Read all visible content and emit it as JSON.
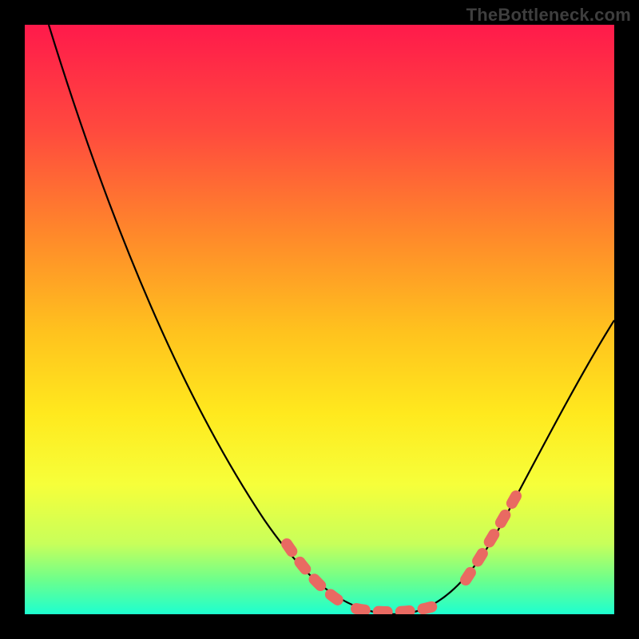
{
  "watermark": "TheBottleneck.com",
  "chart_data": {
    "type": "line",
    "title": "",
    "xlabel": "",
    "ylabel": "",
    "xlim": [
      0,
      100
    ],
    "ylim": [
      0,
      100
    ],
    "series": [
      {
        "name": "curve",
        "x": [
          4,
          10,
          16,
          22,
          28,
          34,
          40,
          46,
          50,
          54,
          58,
          62,
          66,
          70,
          74,
          78,
          82,
          86,
          90,
          94,
          98,
          100
        ],
        "y": [
          100,
          88,
          76,
          64,
          52,
          40,
          29,
          19,
          12,
          7,
          3,
          1,
          0,
          0.5,
          2,
          5,
          9,
          14,
          20,
          27,
          35,
          39
        ]
      }
    ],
    "highlighted_segments": [
      {
        "name": "descent-tail",
        "x0": 48,
        "x1": 58
      },
      {
        "name": "trough",
        "x0": 58,
        "x1": 70
      },
      {
        "name": "ascent-start",
        "x0": 74,
        "x1": 82
      }
    ],
    "colors": {
      "curve": "#000000",
      "highlight": "#e96a62"
    }
  }
}
